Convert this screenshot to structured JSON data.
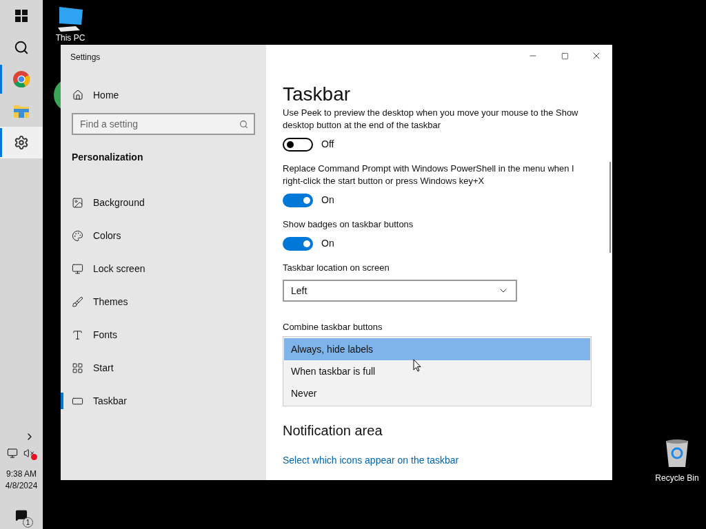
{
  "taskbar": {
    "apps": [
      {
        "kind": "start",
        "running": false,
        "selected": false
      },
      {
        "kind": "search",
        "running": false,
        "selected": false
      },
      {
        "kind": "chrome",
        "running": true,
        "selected": false
      },
      {
        "kind": "explorer",
        "running": false,
        "selected": false
      },
      {
        "kind": "settings",
        "running": true,
        "selected": true
      }
    ],
    "clock": {
      "time": "9:38 AM",
      "date": "4/8/2024"
    },
    "notification_count": "1",
    "volume_muted": true
  },
  "desktop_icons": [
    {
      "kind": "pc",
      "label": "This PC"
    },
    {
      "kind": "recycle",
      "label": "Recycle Bin"
    }
  ],
  "window": {
    "title": "Settings",
    "sidebar": {
      "home": "Home",
      "search": {
        "placeholder": "Find a setting"
      },
      "section": "Personalization",
      "items": [
        {
          "kind": "background",
          "label": "Background",
          "selected": false
        },
        {
          "kind": "colors",
          "label": "Colors",
          "selected": false
        },
        {
          "kind": "lock",
          "label": "Lock screen",
          "selected": false
        },
        {
          "kind": "themes",
          "label": "Themes",
          "selected": false
        },
        {
          "kind": "fonts",
          "label": "Fonts",
          "selected": false
        },
        {
          "kind": "start",
          "label": "Start",
          "selected": false
        },
        {
          "kind": "taskbar",
          "label": "Taskbar",
          "selected": true
        }
      ]
    },
    "content": {
      "title": "Taskbar",
      "toggles": [
        {
          "label": "Use Peek to preview the desktop when you move your mouse to the Show desktop button at the end of the taskbar",
          "on": false,
          "state_text": "Off"
        },
        {
          "label": "Replace Command Prompt with Windows PowerShell in the menu when I right-click the start button or press Windows key+X",
          "on": true,
          "state_text": "On"
        },
        {
          "label": "Show badges on taskbar buttons",
          "on": true,
          "state_text": "On"
        }
      ],
      "location": {
        "label": "Taskbar location on screen",
        "value": "Left"
      },
      "combine": {
        "label": "Combine taskbar buttons",
        "options": [
          {
            "label": "Always, hide labels",
            "selected": true
          },
          {
            "label": "When taskbar is full",
            "selected": false
          },
          {
            "label": "Never",
            "selected": false
          }
        ]
      },
      "notification_heading": "Notification area",
      "link": "Select which icons appear on the taskbar"
    }
  }
}
